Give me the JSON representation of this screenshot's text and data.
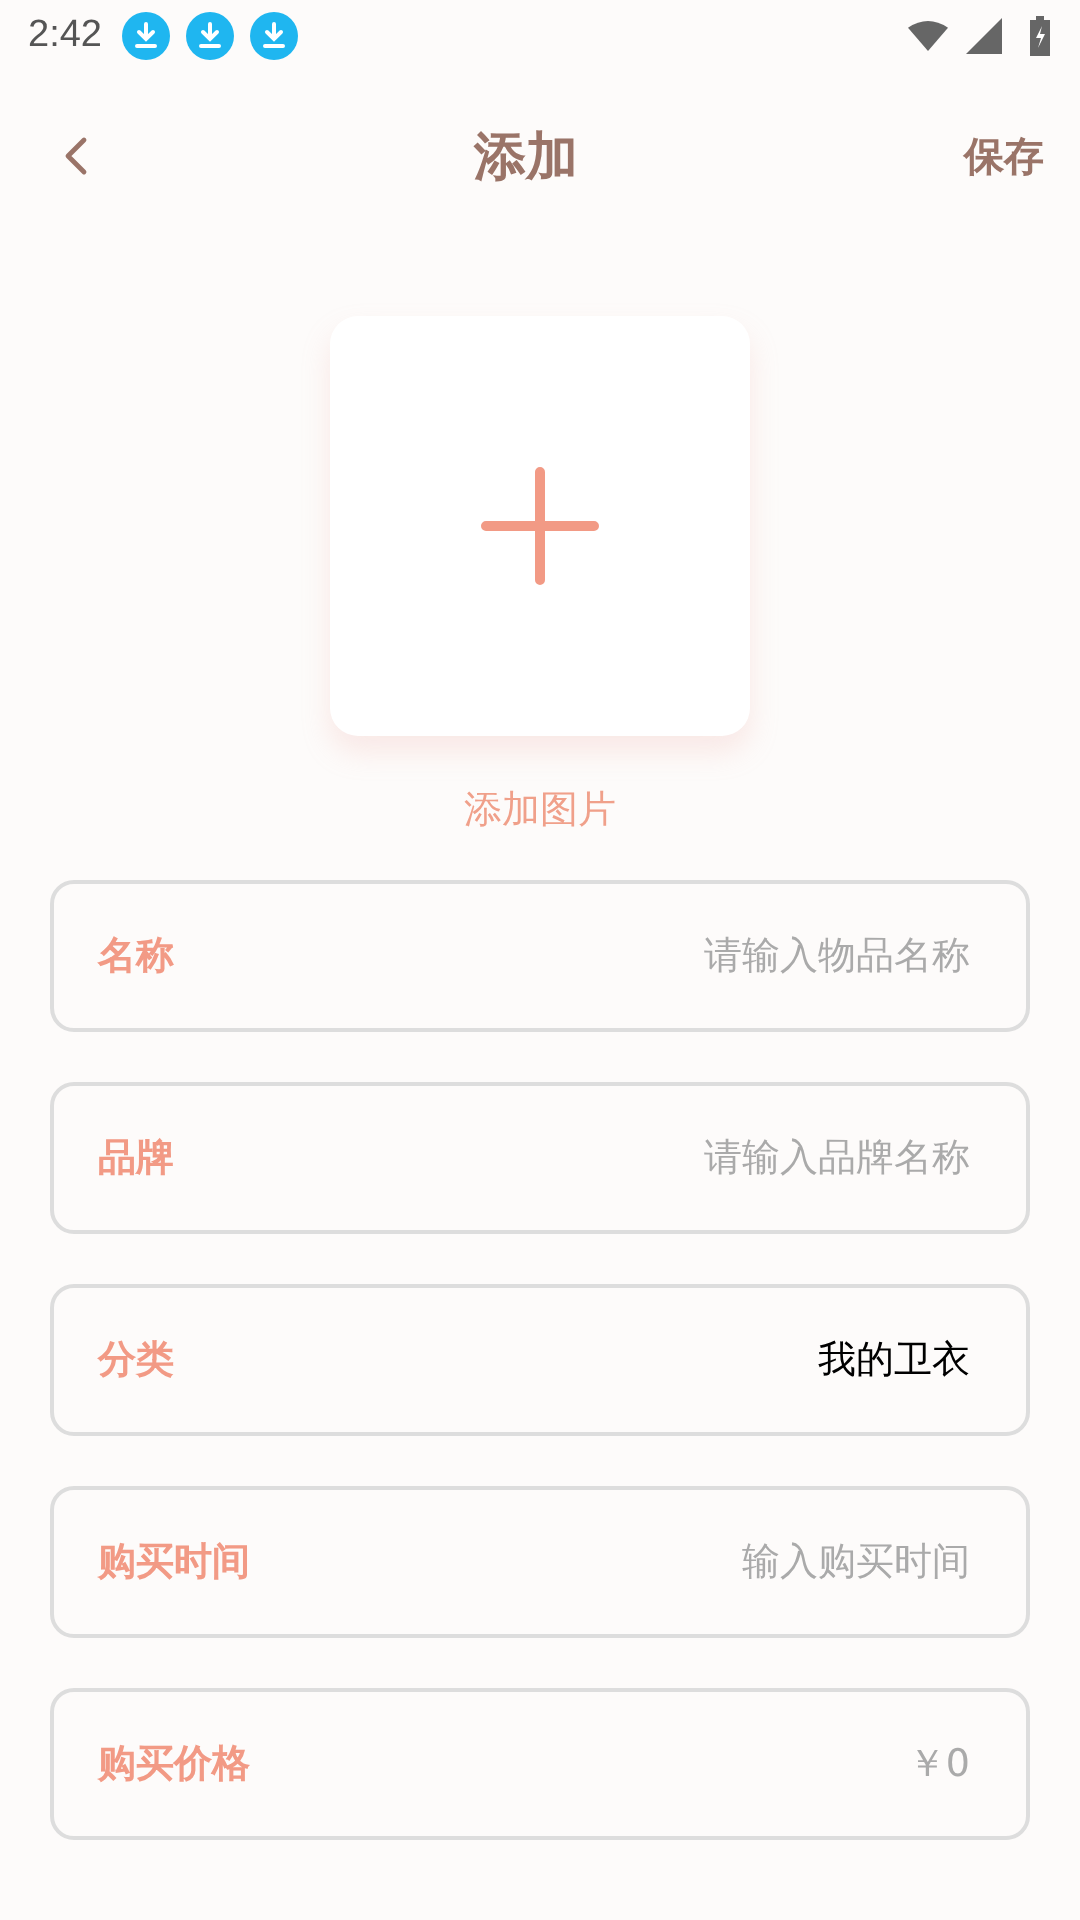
{
  "status_bar": {
    "time": "2:42",
    "notifications": [
      {
        "kind": "download"
      },
      {
        "kind": "download"
      },
      {
        "kind": "download"
      }
    ]
  },
  "header": {
    "title": "添加",
    "action": "保存"
  },
  "image_picker": {
    "label": "添加图片"
  },
  "fields": [
    {
      "label": "名称",
      "placeholder": "请输入物品名称"
    },
    {
      "label": "品牌",
      "placeholder": "请输入品牌名称"
    },
    {
      "label": "分类",
      "value": "我的卫衣"
    },
    {
      "label": "购买时间",
      "placeholder": "输入购买时间"
    },
    {
      "label": "购买价格",
      "placeholder": "￥0"
    }
  ]
}
